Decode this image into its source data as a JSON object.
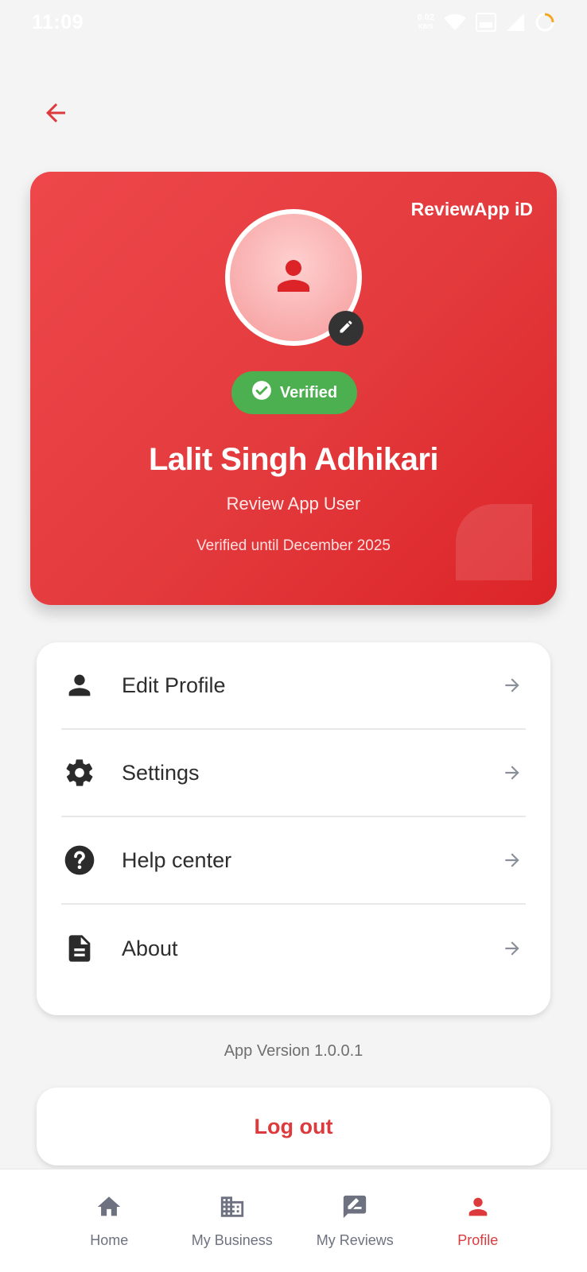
{
  "status_bar": {
    "time": "11:09",
    "net_speed_value": "0.02",
    "net_speed_unit": "KB/S",
    "icons": [
      "wifi-icon",
      "volte-icon",
      "signal-icon",
      "battery-icon"
    ]
  },
  "header": {
    "back_icon": "arrow-left-icon"
  },
  "id_card": {
    "brand": "ReviewApp iD",
    "badge": "Verified",
    "name": "Lalit Singh Adhikari",
    "role": "Review App User",
    "valid_until": "Verified until December 2025",
    "accent_color": "#e33a3d"
  },
  "menu": {
    "items": [
      {
        "label": "Edit Profile",
        "icon": "person-icon"
      },
      {
        "label": "Settings",
        "icon": "gear-icon"
      },
      {
        "label": "Help center",
        "icon": "help-icon"
      },
      {
        "label": "About",
        "icon": "document-icon"
      }
    ]
  },
  "app_version": "App Version 1.0.0.1",
  "logout_label": "Log out",
  "bottom_nav": {
    "items": [
      {
        "label": "Home",
        "icon": "home-icon"
      },
      {
        "label": "My Business",
        "icon": "business-icon"
      },
      {
        "label": "My Reviews",
        "icon": "reviews-icon"
      },
      {
        "label": "Profile",
        "icon": "profile-icon"
      }
    ],
    "active": "Profile",
    "active_color": "#dc3a3d"
  }
}
